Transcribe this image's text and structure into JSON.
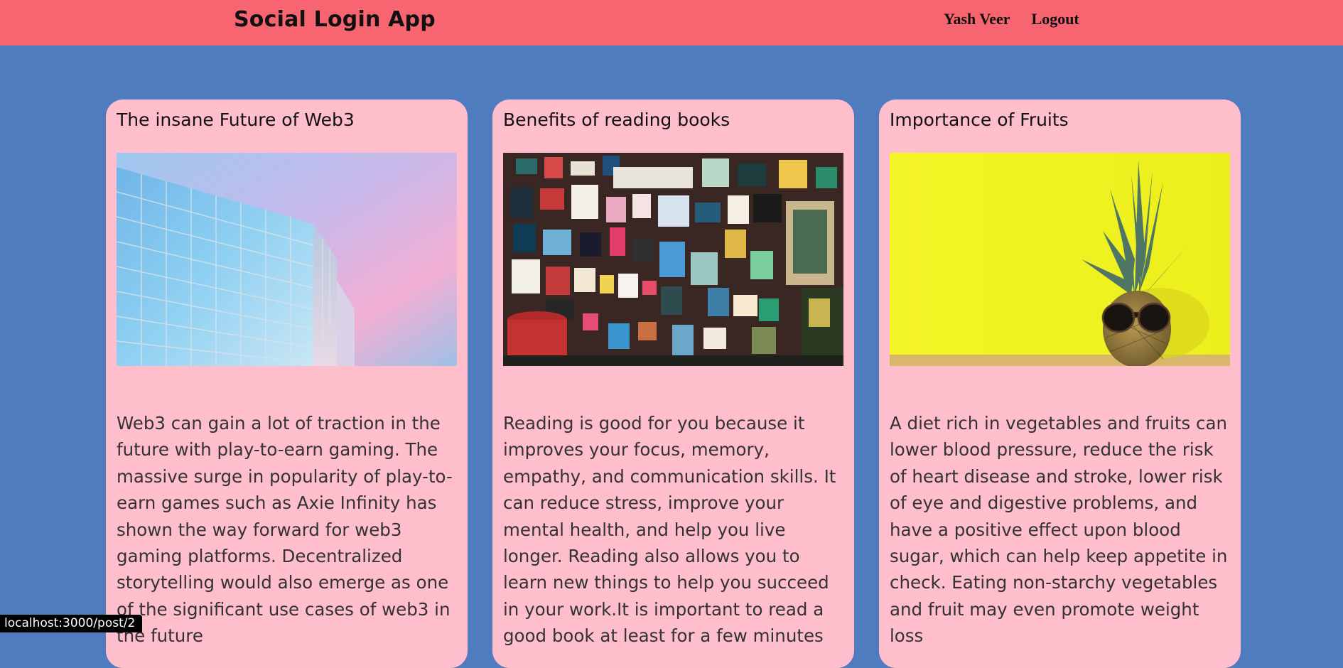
{
  "navbar": {
    "brand": "Social Login App",
    "user_name": "Yash Veer",
    "logout_label": "Logout",
    "background_color": "#f76670"
  },
  "page": {
    "background_color": "#4f7bbf",
    "card_color": "#ffbecb"
  },
  "posts": [
    {
      "title": "The insane Future of Web3",
      "image_alt": "glass building against pink sky",
      "body": "Web3 can gain a lot of traction in the future with play-to-earn gaming. The massive surge in popularity of play-to-earn games such as Axie Infinity has shown the way forward for web3 gaming platforms. Decentralized storytelling would also emerge as one of the significant use cases of web3 in the future"
    },
    {
      "title": "Benefits of reading books",
      "image_alt": "wall covered with book posters",
      "body": "Reading is good for you because it improves your focus, memory, empathy, and communication skills. It can reduce stress, improve your mental health, and help you live longer. Reading also allows you to learn new things to help you succeed in your work.It is important to read a good book at least for a few minutes"
    },
    {
      "title": "Importance of Fruits",
      "image_alt": "pineapple wearing sunglasses on yellow background",
      "body": "A diet rich in vegetables and fruits can lower blood pressure, reduce the risk of heart disease and stroke, lower risk of eye and digestive problems, and have a positive effect upon blood sugar, which can help keep appetite in check. Eating non-starchy vegetables and fruit may even promote weight loss"
    }
  ],
  "status_bar": {
    "url": "localhost:3000/post/2"
  }
}
